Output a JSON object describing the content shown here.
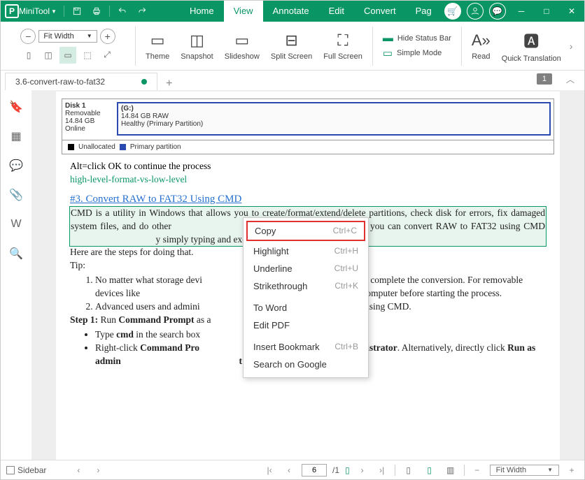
{
  "app": {
    "name": "MiniTool"
  },
  "menu": [
    "Home",
    "View",
    "Annotate",
    "Edit",
    "Convert",
    "Pag"
  ],
  "menu_active": 1,
  "ribbon": {
    "fit_label": "Fit Width",
    "tools": [
      "Theme",
      "Snapshot",
      "Slideshow",
      "Split Screen",
      "Full Screen"
    ],
    "stack": [
      "Hide Status Bar",
      "Simple Mode"
    ],
    "tools2": [
      "Read",
      "Quick Translation"
    ]
  },
  "doc_tab": {
    "title": "3.6-convert-raw-to-fat32",
    "page_badge": "1"
  },
  "embedded": {
    "disk_title": "Disk 1",
    "disk_type": "Removable",
    "disk_size": "14.84 GB",
    "disk_status": "Online",
    "part_letter": "(G:)",
    "part_size": "14.84 GB RAW",
    "part_state": "Healthy (Primary Partition)",
    "legend_unalloc": "Unallocated",
    "legend_primary": "Primary partition"
  },
  "doc": {
    "alt_line": "Alt=click OK to continue the process",
    "green_link": "high-level-format-vs-low-level",
    "heading": "#3. Convert RAW to FAT32 Using CMD",
    "para1_a": "CMD is a utility in Windows that allows you to create/format/extend/delete partitions, check disk for errors, fix damaged system files, and do other",
    "para1_b": "ough command lines. Here, you can convert RAW to FAT32 using CMD",
    "para1_c": "y simply typing and executing some command lines.",
    "steps_intro": "Here are the steps for doing that.",
    "tip_label": "Tip:",
    "ol1_a": "No matter what storage devi",
    "ol1_b": "eps below to complete the conversion. For removable devices like ",
    "ol1_c": "hould connect them to your computer before starting the process.",
    "ol2_a": "Advanced users and admini",
    "ol2_b": "V to FAT32 using CMD.",
    "step1_a": "Step 1:",
    "step1_b": " Run ",
    "step1_c": "Command Prompt",
    "step1_d": " as a",
    "ul1_a": "Type ",
    "ul1_b": "cmd",
    "ul1_c": " in the search box",
    "ul2_a": "Right-click ",
    "ul2_b": "Command Pro",
    "ul2_c": "un as administrator",
    "ul2_d": ". Alternatively, directly click ",
    "ul2_e": "Run as admin",
    "ul2_f": "t App",
    "ul2_g": "."
  },
  "context_menu": {
    "items": [
      {
        "label": "Copy",
        "shortcut": "Ctrl+C"
      },
      {
        "label": "Highlight",
        "shortcut": "Ctrl+H"
      },
      {
        "label": "Underline",
        "shortcut": "Ctrl+U"
      },
      {
        "label": "Strikethrough",
        "shortcut": "Ctrl+K"
      },
      {
        "label": "To Word",
        "shortcut": ""
      },
      {
        "label": "Edit PDF",
        "shortcut": ""
      },
      {
        "label": "Insert Bookmark",
        "shortcut": "Ctrl+B"
      },
      {
        "label": "Search on Google",
        "shortcut": ""
      }
    ]
  },
  "statusbar": {
    "sidebar_label": "Sidebar",
    "current_page": "6",
    "total_pages": "/1",
    "fit_label": "Fit Width"
  }
}
